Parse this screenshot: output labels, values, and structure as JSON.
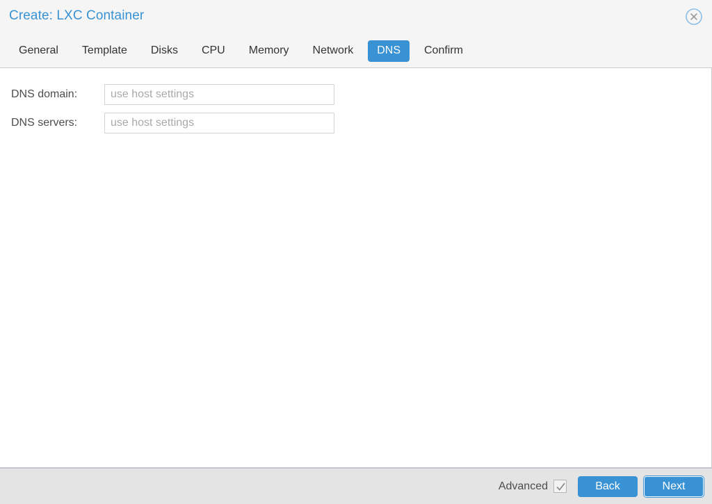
{
  "window": {
    "title": "Create: LXC Container",
    "close_icon": "close-circle-icon",
    "accent_color": "#3892d4",
    "header_bg": "#f5f5f5",
    "footer_bg": "#e4e4e4"
  },
  "tabs": [
    {
      "label": "General",
      "active": false
    },
    {
      "label": "Template",
      "active": false
    },
    {
      "label": "Disks",
      "active": false
    },
    {
      "label": "CPU",
      "active": false
    },
    {
      "label": "Memory",
      "active": false
    },
    {
      "label": "Network",
      "active": false
    },
    {
      "label": "DNS",
      "active": true
    },
    {
      "label": "Confirm",
      "active": false
    }
  ],
  "form": {
    "fields": [
      {
        "label": "DNS domain:",
        "value": "",
        "placeholder": "use host settings"
      },
      {
        "label": "DNS servers:",
        "value": "",
        "placeholder": "use host settings"
      }
    ]
  },
  "footer": {
    "advanced_label": "Advanced",
    "advanced_checked": true,
    "back_label": "Back",
    "next_label": "Next"
  }
}
